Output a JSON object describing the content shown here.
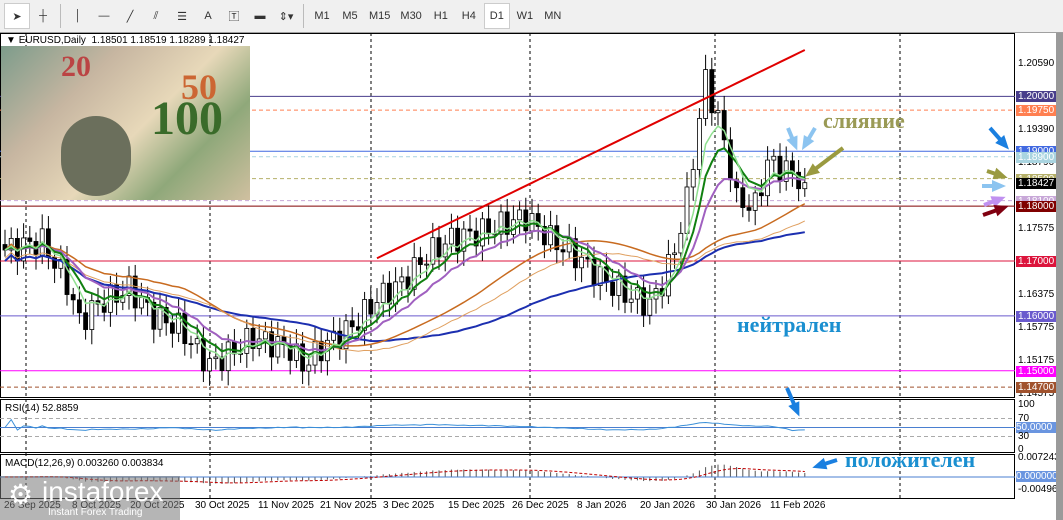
{
  "toolbar": {
    "tools": [
      "cursor-icon",
      "crosshair-icon",
      "vertical-line-icon",
      "horizontal-line-icon",
      "trendline-icon",
      "fibonacci-fan-icon",
      "fibonacci-retracement-icon",
      "text-icon",
      "text-label-icon",
      "rectangle-icon",
      "arrows-icon"
    ],
    "text_tool": "A",
    "timeframes": [
      "M1",
      "M5",
      "M15",
      "M30",
      "H1",
      "H4",
      "D1",
      "W1",
      "MN"
    ],
    "active_timeframe": "D1"
  },
  "header": {
    "symbol": "EURUSD,Daily",
    "open": "1.18501",
    "high": "1.18519",
    "low": "1.18289",
    "close": "1.18427"
  },
  "money_image": {
    "text": "100"
  },
  "price_axis": {
    "ticks": [
      "1.20590",
      "1.19390",
      "1.18790",
      "1.17575",
      "1.16375",
      "1.15775",
      "1.15175",
      "1.14575"
    ],
    "levels": [
      {
        "v": "1.20000",
        "c": "#483d8b"
      },
      {
        "v": "1.19750",
        "c": "#ff7f50",
        "dash": true
      },
      {
        "v": "1.19000",
        "c": "#4169e1"
      },
      {
        "v": "1.18900",
        "c": "#a9d4e0",
        "dash": true
      },
      {
        "v": "1.18500",
        "c": "#b5b06a",
        "dash": true
      },
      {
        "v": "1.18427",
        "c": "#000000"
      },
      {
        "v": "1.18100",
        "c": "#c8a8d8",
        "dash": true
      },
      {
        "v": "1.18000",
        "c": "#800000"
      },
      {
        "v": "1.17000",
        "c": "#dc143c"
      },
      {
        "v": "1.16000",
        "c": "#6a5acd"
      },
      {
        "v": "1.15000",
        "c": "#ff00ff"
      },
      {
        "v": "1.14700",
        "c": "#a0522d",
        "dash": true
      }
    ]
  },
  "rsi": {
    "label": "RSI(14) 52.8859",
    "ticks": [
      "100",
      "70",
      "50.0000",
      "30",
      "0"
    ]
  },
  "macd": {
    "label": "MACD(12,26,9) 0.003260 0.003834",
    "ticks": [
      "0.007243",
      "0.000000",
      "-0.004969"
    ]
  },
  "dates": [
    "26 Sep 2025",
    "8 Oct 2025",
    "20 Oct 2025",
    "30 Oct 2025",
    "11 Nov 2025",
    "21 Nov 2025",
    "3 Dec 2025",
    "15 Dec 2025",
    "26 Dec 2025",
    "8 Jan 2026",
    "20 Jan 2026",
    "30 Jan 2026",
    "11 Feb 2026"
  ],
  "annotations": {
    "merge": "слияние",
    "neutral": "нейтрален",
    "positive": "положителен"
  },
  "watermark": {
    "brand": "instaforex",
    "tagline": "Instant Forex Trading"
  },
  "chart_data": {
    "type": "candlestick",
    "symbol": "EURUSD",
    "timeframe": "Daily",
    "close_keypoints": [
      [
        0,
        1.172
      ],
      [
        6,
        1.1735
      ],
      [
        10,
        1.166
      ],
      [
        12,
        1.159
      ],
      [
        15,
        1.162
      ],
      [
        20,
        1.165
      ],
      [
        24,
        1.16
      ],
      [
        28,
        1.158
      ],
      [
        33,
        1.151
      ],
      [
        36,
        1.153
      ],
      [
        40,
        1.156
      ],
      [
        46,
        1.154
      ],
      [
        48,
        1.151
      ],
      [
        52,
        1.155
      ],
      [
        56,
        1.158
      ],
      [
        60,
        1.163
      ],
      [
        64,
        1.166
      ],
      [
        68,
        1.171
      ],
      [
        72,
        1.174
      ],
      [
        76,
        1.175
      ],
      [
        80,
        1.1765
      ],
      [
        84,
        1.178
      ],
      [
        88,
        1.174
      ],
      [
        92,
        1.171
      ],
      [
        96,
        1.167
      ],
      [
        100,
        1.164
      ],
      [
        104,
        1.162
      ],
      [
        106,
        1.166
      ],
      [
        108,
        1.172
      ],
      [
        110,
        1.181
      ],
      [
        112,
        1.196
      ],
      [
        113,
        1.203
      ],
      [
        115,
        1.196
      ],
      [
        117,
        1.187
      ],
      [
        118,
        1.181
      ],
      [
        121,
        1.18
      ],
      [
        123,
        1.188
      ],
      [
        125,
        1.187
      ],
      [
        127,
        1.186
      ],
      [
        129,
        1.1843
      ]
    ],
    "ylim": [
      1.1435,
      1.2105
    ]
  }
}
